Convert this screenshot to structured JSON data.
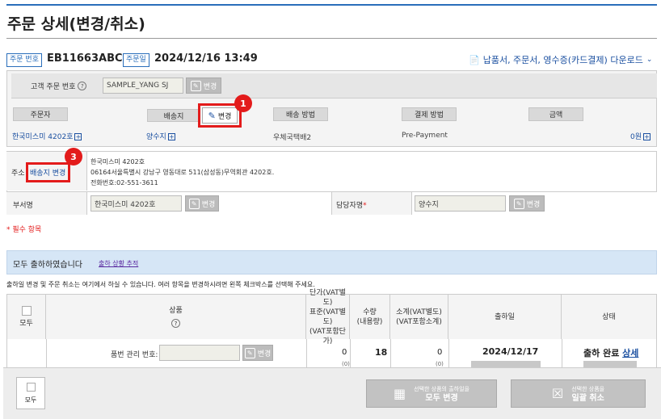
{
  "page": {
    "title": "주문 상세(변경/취소)"
  },
  "order": {
    "number_tag": "주문 번호",
    "number": "EB11663ABC",
    "date_tag": "주문일",
    "date": "2024/12/16 13:49",
    "download_link": "납품서, 주문서, 영수증(카드결제) 다운로드"
  },
  "customer_order_no": {
    "label": "고객 주문 번호",
    "value": "SAMPLE_YANG SJ",
    "change": "변경"
  },
  "columns": {
    "orderer": "주문자",
    "ship_to": "배송지",
    "ship_to_change": "변경",
    "ship_method": "배송 방법",
    "payment": "결제 방법",
    "amount": "금액"
  },
  "values": {
    "orderer": "한국미스미 4202호",
    "ship_to": "양수지",
    "ship_method": "우체국택배2",
    "payment": "Pre-Payment",
    "amount": "0원"
  },
  "address": {
    "label": "주소",
    "change_button": "배송지 변경",
    "line1": "한국미스미 4202호",
    "line2": "06164서울특별시 강남구 영동대로 511(삼성동)무역회관 4202호.",
    "line3": "전화번호:02-551-3611"
  },
  "dept": {
    "label": "부서명",
    "value": "한국미스미 4202호",
    "change": "변경",
    "manager_label": "담당자명",
    "manager_value": "양수지",
    "manager_change": "변경"
  },
  "required_note": "* 필수 항목",
  "shipping": {
    "status": "모두 출하하였습니다",
    "trace_link": "출하 상황 추적",
    "note": "출하일 변경 및 주문 취소는 여기에서 하실 수 있습니다. 여러 항목을 변경하시려면 왼쪽 체크박스를 선택해 주세요."
  },
  "table": {
    "all": "모두",
    "product": "상품",
    "unit_price": [
      "단가(VAT별도)",
      "표준(VAT별도)",
      "(VAT포함단가)"
    ],
    "qty": [
      "수량",
      "(내용량)"
    ],
    "subtotal": [
      "소계(VAT별도)",
      "(VAT포함소계)"
    ],
    "ship_date": "출하일",
    "status": "상태",
    "row": {
      "part_label": "품번 관리 번호:",
      "part_change": "변경",
      "unit_price": "0",
      "unit_sub": "(0)",
      "qty": "18",
      "subtotal": "0",
      "subtotal_sub": "(0)",
      "ship_date": "2024/12/17",
      "status": "출하 완료",
      "status_link": "상세"
    }
  },
  "footer": {
    "all": "모두",
    "change_all_small": "선택한 상품의 출하일을",
    "change_all": "모두 변경",
    "cancel_small": "선택한 상품을",
    "cancel": "일괄 취소"
  },
  "badges": {
    "one": "1",
    "three": "3"
  },
  "colors": {
    "accent": "#2a6ebb",
    "highlight": "#e31b1b",
    "shipbar": "#d6e6f6"
  },
  "icons": [
    "pdf-icon",
    "question-icon",
    "edit-icon",
    "plus-icon",
    "calendar-icon",
    "cancel-box-icon",
    "chevron-down-icon"
  ]
}
